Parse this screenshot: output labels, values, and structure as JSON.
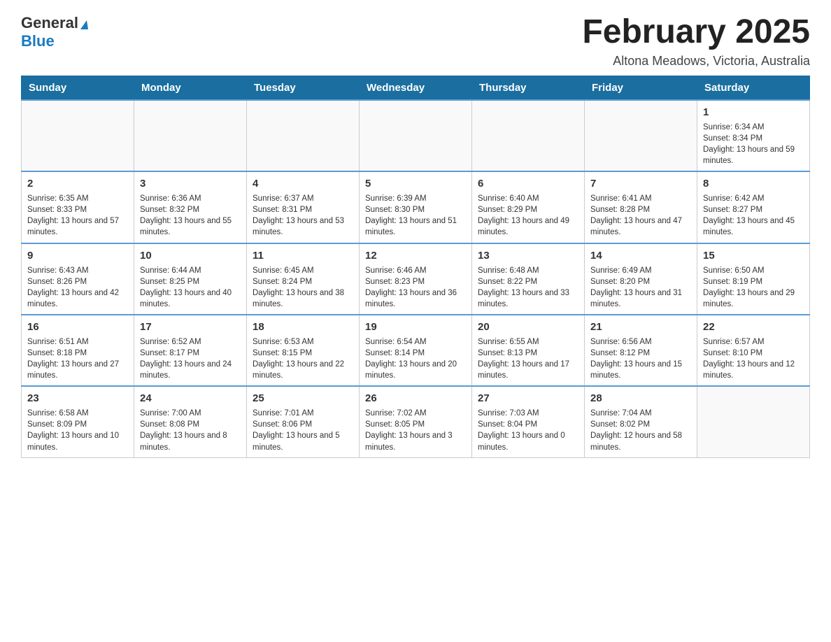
{
  "header": {
    "logo_general": "General",
    "logo_blue": "Blue",
    "month_title": "February 2025",
    "location": "Altona Meadows, Victoria, Australia"
  },
  "days_of_week": [
    "Sunday",
    "Monday",
    "Tuesday",
    "Wednesday",
    "Thursday",
    "Friday",
    "Saturday"
  ],
  "weeks": [
    [
      {
        "day": "",
        "info": ""
      },
      {
        "day": "",
        "info": ""
      },
      {
        "day": "",
        "info": ""
      },
      {
        "day": "",
        "info": ""
      },
      {
        "day": "",
        "info": ""
      },
      {
        "day": "",
        "info": ""
      },
      {
        "day": "1",
        "info": "Sunrise: 6:34 AM\nSunset: 8:34 PM\nDaylight: 13 hours and 59 minutes."
      }
    ],
    [
      {
        "day": "2",
        "info": "Sunrise: 6:35 AM\nSunset: 8:33 PM\nDaylight: 13 hours and 57 minutes."
      },
      {
        "day": "3",
        "info": "Sunrise: 6:36 AM\nSunset: 8:32 PM\nDaylight: 13 hours and 55 minutes."
      },
      {
        "day": "4",
        "info": "Sunrise: 6:37 AM\nSunset: 8:31 PM\nDaylight: 13 hours and 53 minutes."
      },
      {
        "day": "5",
        "info": "Sunrise: 6:39 AM\nSunset: 8:30 PM\nDaylight: 13 hours and 51 minutes."
      },
      {
        "day": "6",
        "info": "Sunrise: 6:40 AM\nSunset: 8:29 PM\nDaylight: 13 hours and 49 minutes."
      },
      {
        "day": "7",
        "info": "Sunrise: 6:41 AM\nSunset: 8:28 PM\nDaylight: 13 hours and 47 minutes."
      },
      {
        "day": "8",
        "info": "Sunrise: 6:42 AM\nSunset: 8:27 PM\nDaylight: 13 hours and 45 minutes."
      }
    ],
    [
      {
        "day": "9",
        "info": "Sunrise: 6:43 AM\nSunset: 8:26 PM\nDaylight: 13 hours and 42 minutes."
      },
      {
        "day": "10",
        "info": "Sunrise: 6:44 AM\nSunset: 8:25 PM\nDaylight: 13 hours and 40 minutes."
      },
      {
        "day": "11",
        "info": "Sunrise: 6:45 AM\nSunset: 8:24 PM\nDaylight: 13 hours and 38 minutes."
      },
      {
        "day": "12",
        "info": "Sunrise: 6:46 AM\nSunset: 8:23 PM\nDaylight: 13 hours and 36 minutes."
      },
      {
        "day": "13",
        "info": "Sunrise: 6:48 AM\nSunset: 8:22 PM\nDaylight: 13 hours and 33 minutes."
      },
      {
        "day": "14",
        "info": "Sunrise: 6:49 AM\nSunset: 8:20 PM\nDaylight: 13 hours and 31 minutes."
      },
      {
        "day": "15",
        "info": "Sunrise: 6:50 AM\nSunset: 8:19 PM\nDaylight: 13 hours and 29 minutes."
      }
    ],
    [
      {
        "day": "16",
        "info": "Sunrise: 6:51 AM\nSunset: 8:18 PM\nDaylight: 13 hours and 27 minutes."
      },
      {
        "day": "17",
        "info": "Sunrise: 6:52 AM\nSunset: 8:17 PM\nDaylight: 13 hours and 24 minutes."
      },
      {
        "day": "18",
        "info": "Sunrise: 6:53 AM\nSunset: 8:15 PM\nDaylight: 13 hours and 22 minutes."
      },
      {
        "day": "19",
        "info": "Sunrise: 6:54 AM\nSunset: 8:14 PM\nDaylight: 13 hours and 20 minutes."
      },
      {
        "day": "20",
        "info": "Sunrise: 6:55 AM\nSunset: 8:13 PM\nDaylight: 13 hours and 17 minutes."
      },
      {
        "day": "21",
        "info": "Sunrise: 6:56 AM\nSunset: 8:12 PM\nDaylight: 13 hours and 15 minutes."
      },
      {
        "day": "22",
        "info": "Sunrise: 6:57 AM\nSunset: 8:10 PM\nDaylight: 13 hours and 12 minutes."
      }
    ],
    [
      {
        "day": "23",
        "info": "Sunrise: 6:58 AM\nSunset: 8:09 PM\nDaylight: 13 hours and 10 minutes."
      },
      {
        "day": "24",
        "info": "Sunrise: 7:00 AM\nSunset: 8:08 PM\nDaylight: 13 hours and 8 minutes."
      },
      {
        "day": "25",
        "info": "Sunrise: 7:01 AM\nSunset: 8:06 PM\nDaylight: 13 hours and 5 minutes."
      },
      {
        "day": "26",
        "info": "Sunrise: 7:02 AM\nSunset: 8:05 PM\nDaylight: 13 hours and 3 minutes."
      },
      {
        "day": "27",
        "info": "Sunrise: 7:03 AM\nSunset: 8:04 PM\nDaylight: 13 hours and 0 minutes."
      },
      {
        "day": "28",
        "info": "Sunrise: 7:04 AM\nSunset: 8:02 PM\nDaylight: 12 hours and 58 minutes."
      },
      {
        "day": "",
        "info": ""
      }
    ]
  ]
}
